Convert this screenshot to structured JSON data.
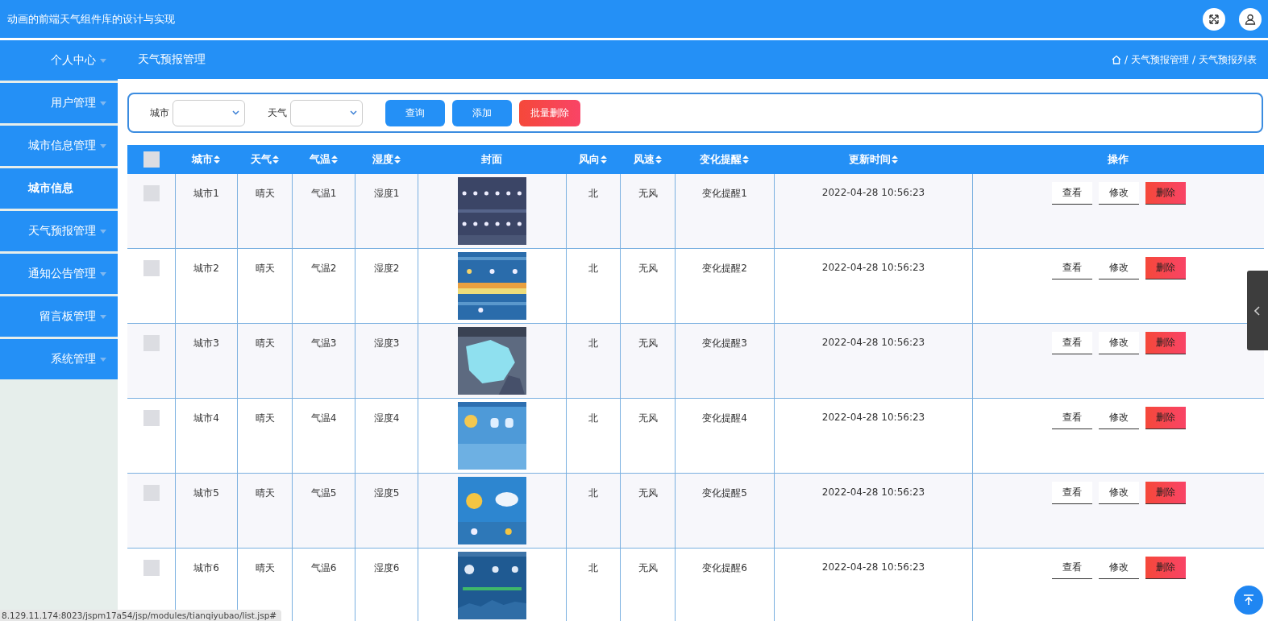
{
  "header": {
    "title": "动画的前端天气组件库的设计与实现"
  },
  "sidebar": {
    "items": [
      {
        "label": "个人中心",
        "kind": "menu"
      },
      {
        "label": "用户管理",
        "kind": "menu"
      },
      {
        "label": "城市信息管理",
        "kind": "menu"
      },
      {
        "label": "城市信息",
        "kind": "submenu"
      },
      {
        "label": "天气预报管理",
        "kind": "menu"
      },
      {
        "label": "通知公告管理",
        "kind": "menu"
      },
      {
        "label": "留言板管理",
        "kind": "menu"
      },
      {
        "label": "系统管理",
        "kind": "menu"
      }
    ]
  },
  "page": {
    "title": "天气预报管理",
    "breadcrumb": {
      "separator": "/",
      "items": [
        "天气预报管理",
        "天气预报列表"
      ]
    }
  },
  "search": {
    "fields": [
      {
        "label": "城市"
      },
      {
        "label": "天气"
      }
    ],
    "buttons": [
      {
        "label": "查询",
        "kind": "primary"
      },
      {
        "label": "添加",
        "kind": "primary"
      },
      {
        "label": "批量删除",
        "kind": "danger"
      }
    ]
  },
  "table": {
    "select_all": {
      "checked": false
    },
    "columns": [
      {
        "label": "城市",
        "sortable": true
      },
      {
        "label": "天气",
        "sortable": true
      },
      {
        "label": "气温",
        "sortable": true
      },
      {
        "label": "湿度",
        "sortable": true
      },
      {
        "label": "封面",
        "sortable": false
      },
      {
        "label": "风向",
        "sortable": true
      },
      {
        "label": "风速",
        "sortable": true
      },
      {
        "label": "变化提醒",
        "sortable": true
      },
      {
        "label": "更新时间",
        "sortable": true
      },
      {
        "label": "操作",
        "sortable": false
      }
    ],
    "rows": [
      {
        "checked": false,
        "city": "城市1",
        "weather": "晴天",
        "temp": "气温1",
        "humidity": "湿度1",
        "direction": "北",
        "speed": "无风",
        "alert": "变化提醒1",
        "updated": "2022-04-28 10:56:23",
        "actions": [
          {
            "label": "查看",
            "kind": "plain"
          },
          {
            "label": "修改",
            "kind": "plain"
          },
          {
            "label": "删除",
            "kind": "danger"
          }
        ]
      },
      {
        "checked": false,
        "city": "城市2",
        "weather": "晴天",
        "temp": "气温2",
        "humidity": "湿度2",
        "direction": "北",
        "speed": "无风",
        "alert": "变化提醒2",
        "updated": "2022-04-28 10:56:23",
        "actions": [
          {
            "label": "查看",
            "kind": "plain"
          },
          {
            "label": "修改",
            "kind": "plain"
          },
          {
            "label": "删除",
            "kind": "danger"
          }
        ]
      },
      {
        "checked": false,
        "city": "城市3",
        "weather": "晴天",
        "temp": "气温3",
        "humidity": "湿度3",
        "direction": "北",
        "speed": "无风",
        "alert": "变化提醒3",
        "updated": "2022-04-28 10:56:23",
        "actions": [
          {
            "label": "查看",
            "kind": "plain"
          },
          {
            "label": "修改",
            "kind": "plain"
          },
          {
            "label": "删除",
            "kind": "danger"
          }
        ]
      },
      {
        "checked": false,
        "city": "城市4",
        "weather": "晴天",
        "temp": "气温4",
        "humidity": "湿度4",
        "direction": "北",
        "speed": "无风",
        "alert": "变化提醒4",
        "updated": "2022-04-28 10:56:23",
        "actions": [
          {
            "label": "查看",
            "kind": "plain"
          },
          {
            "label": "修改",
            "kind": "plain"
          },
          {
            "label": "删除",
            "kind": "danger"
          }
        ]
      },
      {
        "checked": false,
        "city": "城市5",
        "weather": "晴天",
        "temp": "气温5",
        "humidity": "湿度5",
        "direction": "北",
        "speed": "无风",
        "alert": "变化提醒5",
        "updated": "2022-04-28 10:56:23",
        "actions": [
          {
            "label": "查看",
            "kind": "plain"
          },
          {
            "label": "修改",
            "kind": "plain"
          },
          {
            "label": "删除",
            "kind": "danger"
          }
        ]
      },
      {
        "checked": false,
        "city": "城市6",
        "weather": "晴天",
        "temp": "气温6",
        "humidity": "湿度6",
        "direction": "北",
        "speed": "无风",
        "alert": "变化提醒6",
        "updated": "2022-04-28 10:56:23",
        "actions": [
          {
            "label": "查看",
            "kind": "plain"
          },
          {
            "label": "修改",
            "kind": "plain"
          },
          {
            "label": "删除",
            "kind": "danger"
          }
        ]
      }
    ]
  },
  "status_bar": {
    "url": "8.129.11.174:8023/jspm17a54/jsp/modules/tianqiyubao/list.jsp#"
  }
}
